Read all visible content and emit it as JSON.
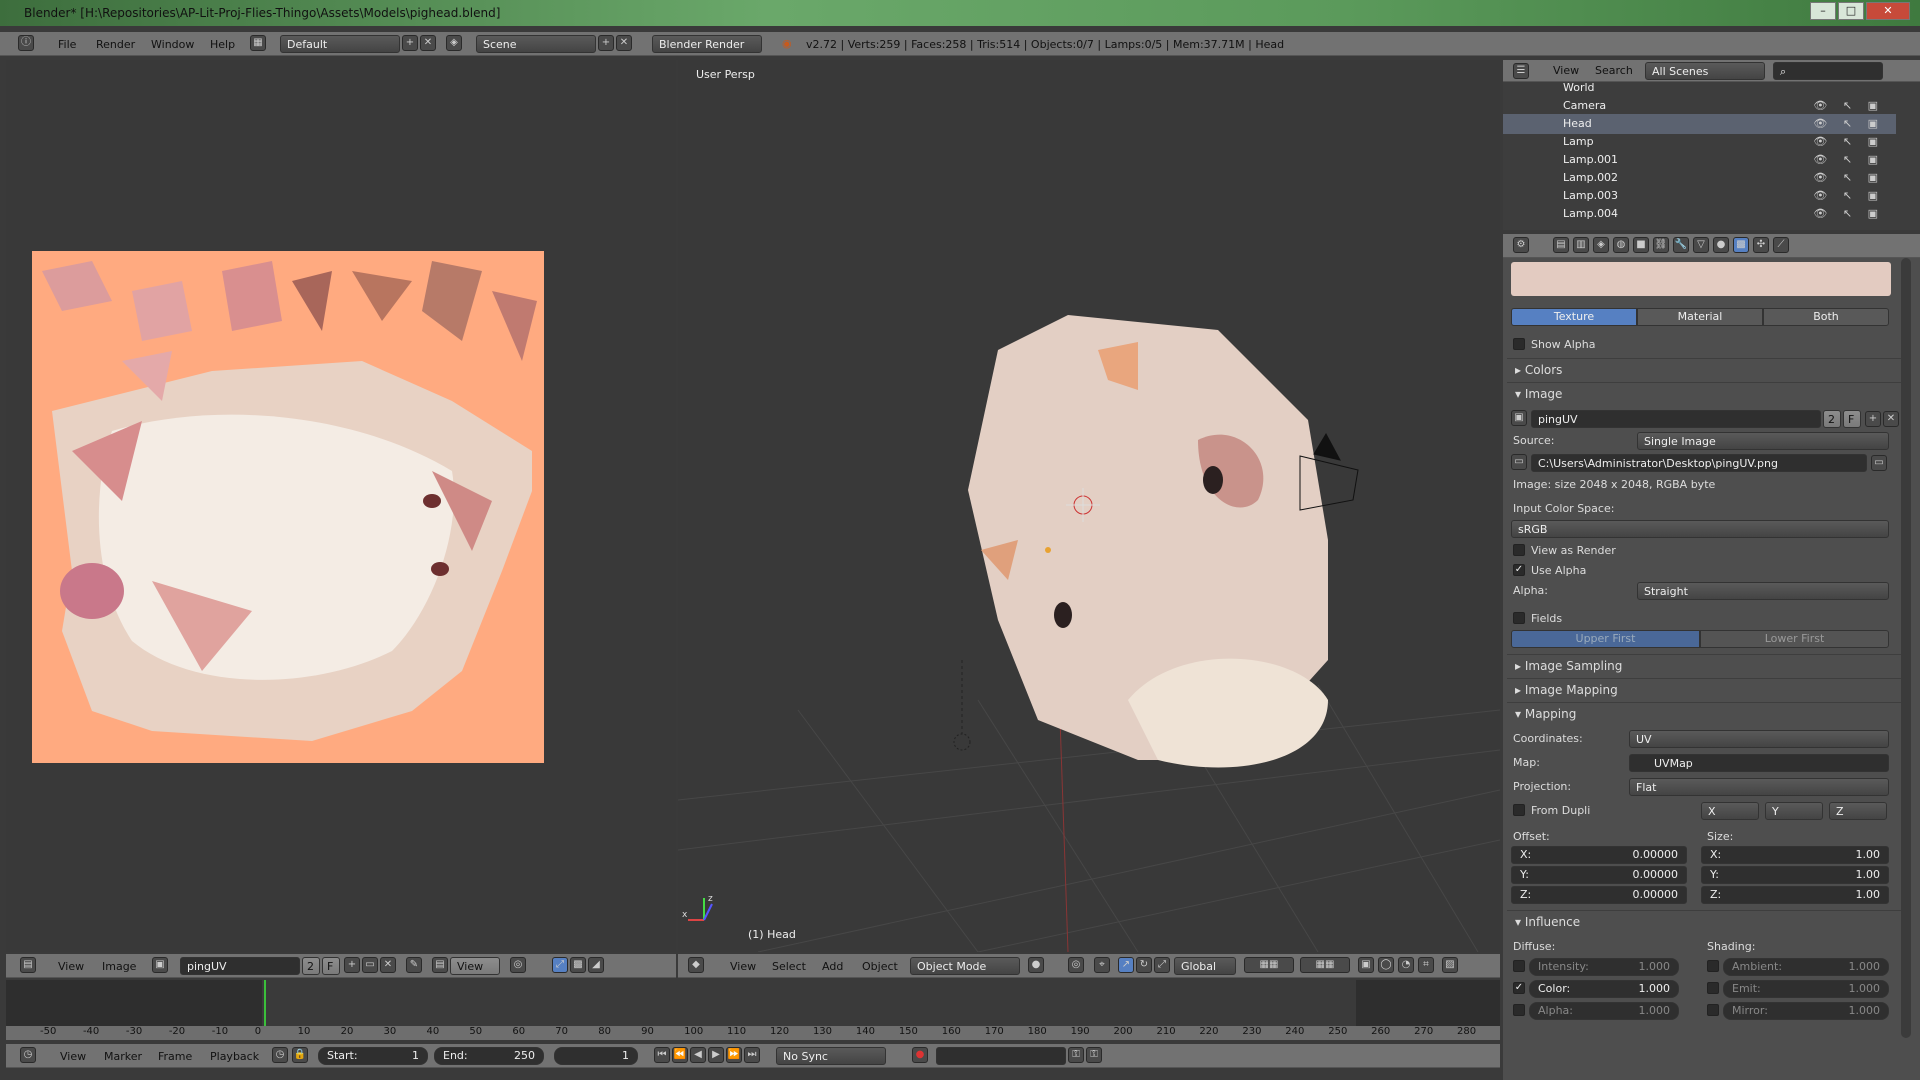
{
  "window": {
    "title": "Blender* [H:\\Repositories\\AP-Lit-Proj-Flies-Thingo\\Assets\\Models\\pighead.blend]",
    "min": "–",
    "max": "□",
    "close": "✕"
  },
  "infoheader": {
    "menus": [
      "File",
      "Render",
      "Window",
      "Help"
    ],
    "layout": "Default",
    "scene": "Scene",
    "engine": "Blender Render",
    "stats": "v2.72 | Verts:259 | Faces:258 | Tris:514 | Objects:0/7 | Lamps:0/5 | Mem:37.71M | Head"
  },
  "uv_editor": {
    "menus": [
      "View",
      "Image"
    ],
    "image_name": "pingUV",
    "users": "2",
    "fake": "F",
    "view_dd": "View"
  },
  "viewport": {
    "label": "User Persp",
    "object_label": "(1) Head",
    "menus": [
      "View",
      "Select",
      "Add",
      "Object"
    ],
    "mode": "Object Mode",
    "orientation": "Global",
    "axis_x": "x",
    "axis_z": "z"
  },
  "outliner": {
    "menus": [
      "View",
      "Search"
    ],
    "filter": "All Scenes",
    "items": [
      {
        "name": "World"
      },
      {
        "name": "Camera"
      },
      {
        "name": "Head",
        "selected": true
      },
      {
        "name": "Lamp"
      },
      {
        "name": "Lamp.001"
      },
      {
        "name": "Lamp.002"
      },
      {
        "name": "Lamp.003"
      },
      {
        "name": "Lamp.004"
      }
    ],
    "row_icons": "👁 ↖ ▣"
  },
  "properties": {
    "tabs": [
      "Texture",
      "Material",
      "Both"
    ],
    "show_alpha": "Show Alpha",
    "colors": "Colors",
    "image": "Image",
    "image_name": "pingUV",
    "users": "2",
    "fake": "F",
    "source_label": "Source:",
    "source": "Single Image",
    "filepath": "C:\\Users\\Administrator\\Desktop\\pingUV.png",
    "image_info": "Image: size 2048 x 2048, RGBA byte",
    "input_color_space": "Input Color Space:",
    "color_space": "sRGB",
    "view_as_render": "View as Render",
    "use_alpha": "Use Alpha",
    "alpha_label": "Alpha:",
    "alpha": "Straight",
    "fields": "Fields",
    "upper_first": "Upper First",
    "lower_first": "Lower First",
    "image_sampling": "Image Sampling",
    "image_mapping": "Image Mapping",
    "mapping": "Mapping",
    "coordinates_label": "Coordinates:",
    "coordinates": "UV",
    "map_label": "Map:",
    "map": "UVMap",
    "projection_label": "Projection:",
    "projection": "Flat",
    "from_dupli": "From Dupli",
    "xyz": [
      "X",
      "Y",
      "Z"
    ],
    "offset_label": "Offset:",
    "size_label": "Size:",
    "offset": [
      {
        "k": "X:",
        "v": "0.00000"
      },
      {
        "k": "Y:",
        "v": "0.00000"
      },
      {
        "k": "Z:",
        "v": "0.00000"
      }
    ],
    "size": [
      {
        "k": "X:",
        "v": "1.00"
      },
      {
        "k": "Y:",
        "v": "1.00"
      },
      {
        "k": "Z:",
        "v": "1.00"
      }
    ],
    "influence": "Influence",
    "diffuse": "Diffuse:",
    "shading": "Shading:",
    "intensity": {
      "k": "Intensity:",
      "v": "1.000"
    },
    "color": {
      "k": "Color:",
      "v": "1.000"
    },
    "alpha_inf": {
      "k": "Alpha:",
      "v": "1.000"
    },
    "ambient": {
      "k": "Ambient:",
      "v": "1.000"
    },
    "emit": {
      "k": "Emit:",
      "v": "1.000"
    },
    "mirror": {
      "k": "Mirror:",
      "v": "1.000"
    }
  },
  "timeline": {
    "ticks": [
      "-50",
      "-40",
      "-30",
      "-20",
      "-10",
      "0",
      "10",
      "20",
      "30",
      "40",
      "50",
      "60",
      "70",
      "80",
      "90",
      "100",
      "110",
      "120",
      "130",
      "140",
      "150",
      "160",
      "170",
      "180",
      "190",
      "200",
      "210",
      "220",
      "230",
      "240",
      "250",
      "260",
      "270",
      "280"
    ],
    "menus": [
      "View",
      "Marker",
      "Frame",
      "Playback"
    ],
    "start_label": "Start:",
    "start": "1",
    "end_label": "End:",
    "end": "250",
    "current": "1",
    "sync": "No Sync"
  },
  "colors": {
    "accent": "#5680c2",
    "texture_bg": "#ffaa80",
    "green_cursor": "#3bbf3b"
  }
}
